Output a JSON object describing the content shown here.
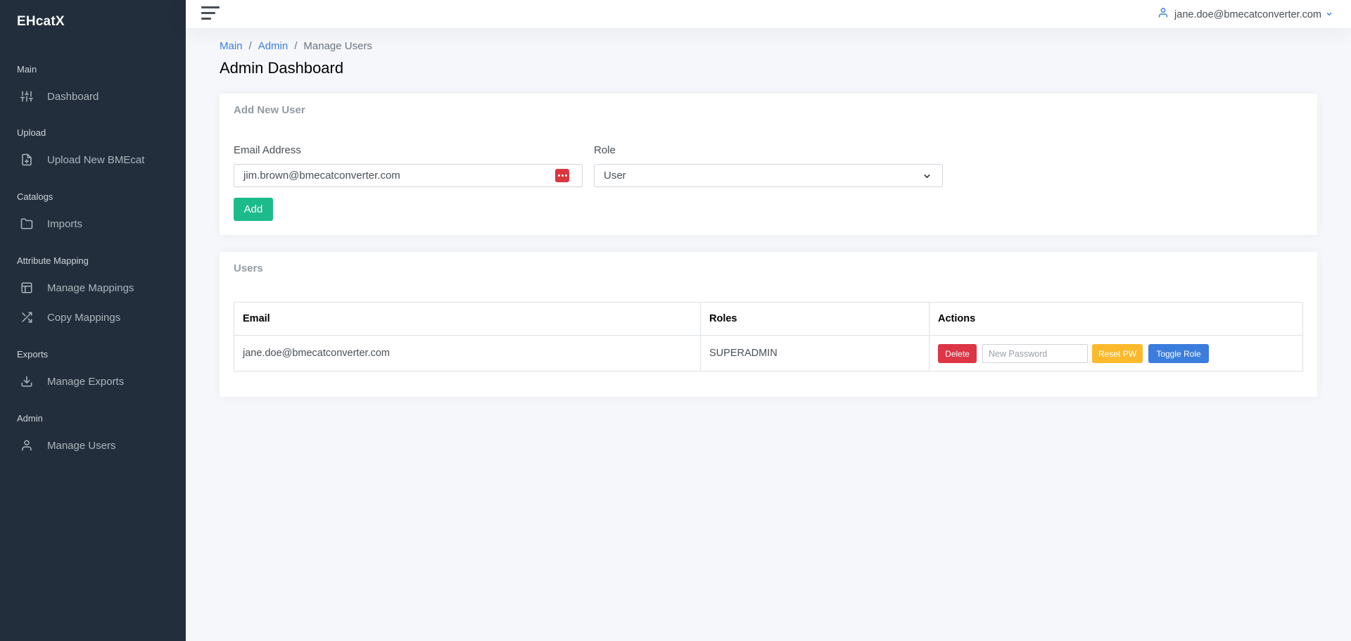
{
  "app": {
    "brand": "EHcatX"
  },
  "sidebar": {
    "sections": [
      {
        "header": "Main",
        "items": [
          {
            "label": "Dashboard",
            "icon": "sliders-icon"
          }
        ]
      },
      {
        "header": "Upload",
        "items": [
          {
            "label": "Upload New BMEcat",
            "icon": "file-plus-icon"
          }
        ]
      },
      {
        "header": "Catalogs",
        "items": [
          {
            "label": "Imports",
            "icon": "folder-icon"
          }
        ]
      },
      {
        "header": "Attribute Mapping",
        "items": [
          {
            "label": "Manage Mappings",
            "icon": "layout-icon"
          },
          {
            "label": "Copy Mappings",
            "icon": "shuffle-icon"
          }
        ]
      },
      {
        "header": "Exports",
        "items": [
          {
            "label": "Manage Exports",
            "icon": "download-icon"
          }
        ]
      },
      {
        "header": "Admin",
        "items": [
          {
            "label": "Manage Users",
            "icon": "user-icon"
          }
        ]
      }
    ]
  },
  "topbar": {
    "user_email": "jane.doe@bmecatconverter.com"
  },
  "breadcrumb": {
    "main": "Main",
    "admin": "Admin",
    "current": "Manage Users",
    "separator": "/"
  },
  "page": {
    "title": "Admin Dashboard"
  },
  "add_user": {
    "title": "Add New User",
    "email_label": "Email Address",
    "email_value": "jim.brown@bmecatconverter.com",
    "role_label": "Role",
    "role_value": "User",
    "add_button": "Add"
  },
  "users": {
    "title": "Users",
    "columns": [
      "Email",
      "Roles",
      "Actions"
    ],
    "rows": [
      {
        "email": "jane.doe@bmecatconverter.com",
        "roles": "SUPERADMIN",
        "delete_label": "Delete",
        "password_placeholder": "New Password",
        "reset_label": "Reset PW",
        "toggle_label": "Toggle Role"
      }
    ]
  },
  "colors": {
    "sidebar_bg": "#222e3c",
    "primary": "#3b7ddd",
    "success": "#1cbb8c",
    "danger": "#dc3545",
    "warning": "#fcb92c"
  }
}
